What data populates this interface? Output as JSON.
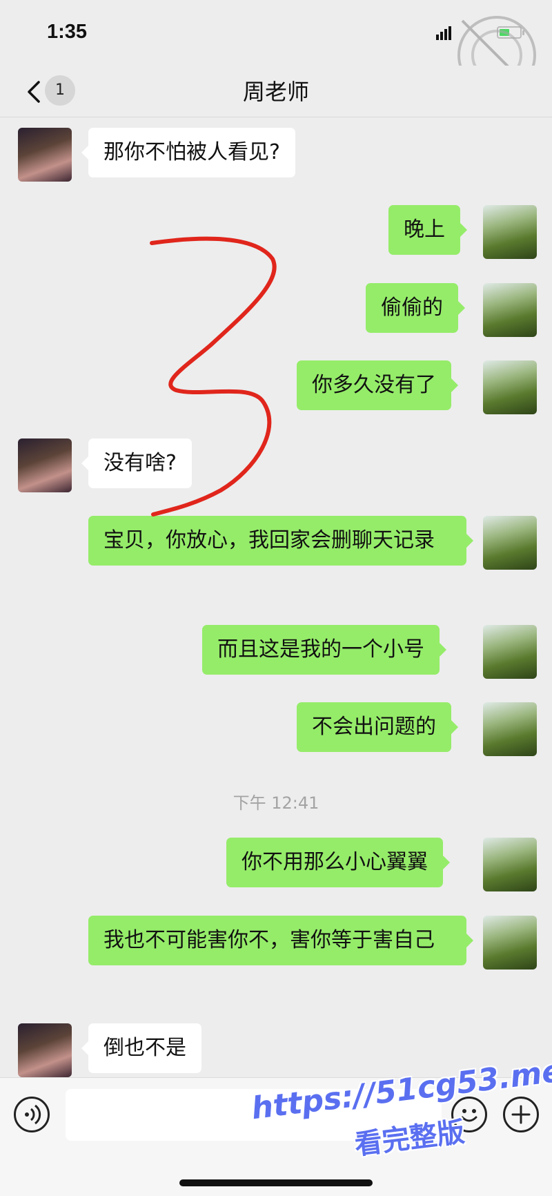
{
  "status_bar": {
    "time": "1:35"
  },
  "nav": {
    "back_badge": "1",
    "title": "周老师"
  },
  "messages": [
    {
      "side": "left",
      "text": "那你不怕被人看见?"
    },
    {
      "side": "right",
      "text": "晚上"
    },
    {
      "side": "right",
      "text": "偷偷的"
    },
    {
      "side": "right",
      "text": "你多久没有了"
    },
    {
      "side": "left",
      "text": "没有啥?"
    },
    {
      "side": "right",
      "text": "宝贝，你放心，我回家会删聊天记录"
    },
    {
      "side": "right",
      "text": "而且这是我的一个小号"
    },
    {
      "side": "right",
      "text": "不会出问题的"
    },
    {
      "side": "right",
      "text": "你不用那么小心翼翼"
    },
    {
      "side": "right",
      "text": "我也不可能害你不，害你等于害自己"
    },
    {
      "side": "left",
      "text": "倒也不是"
    }
  ],
  "timestamp": "下午 12:41",
  "input_bar": {
    "voice_icon": "voice-icon",
    "emoji_icon": "emoji-icon",
    "plus_icon": "plus-icon"
  },
  "watermark": {
    "line1": "https://51cg53.me",
    "line2": "看完整版"
  },
  "colors": {
    "background": "#ededed",
    "bubble_sent": "#95ec69",
    "bubble_received": "#ffffff",
    "annotation_scribble": "#e0261c",
    "watermark": "#5a6ff0"
  }
}
